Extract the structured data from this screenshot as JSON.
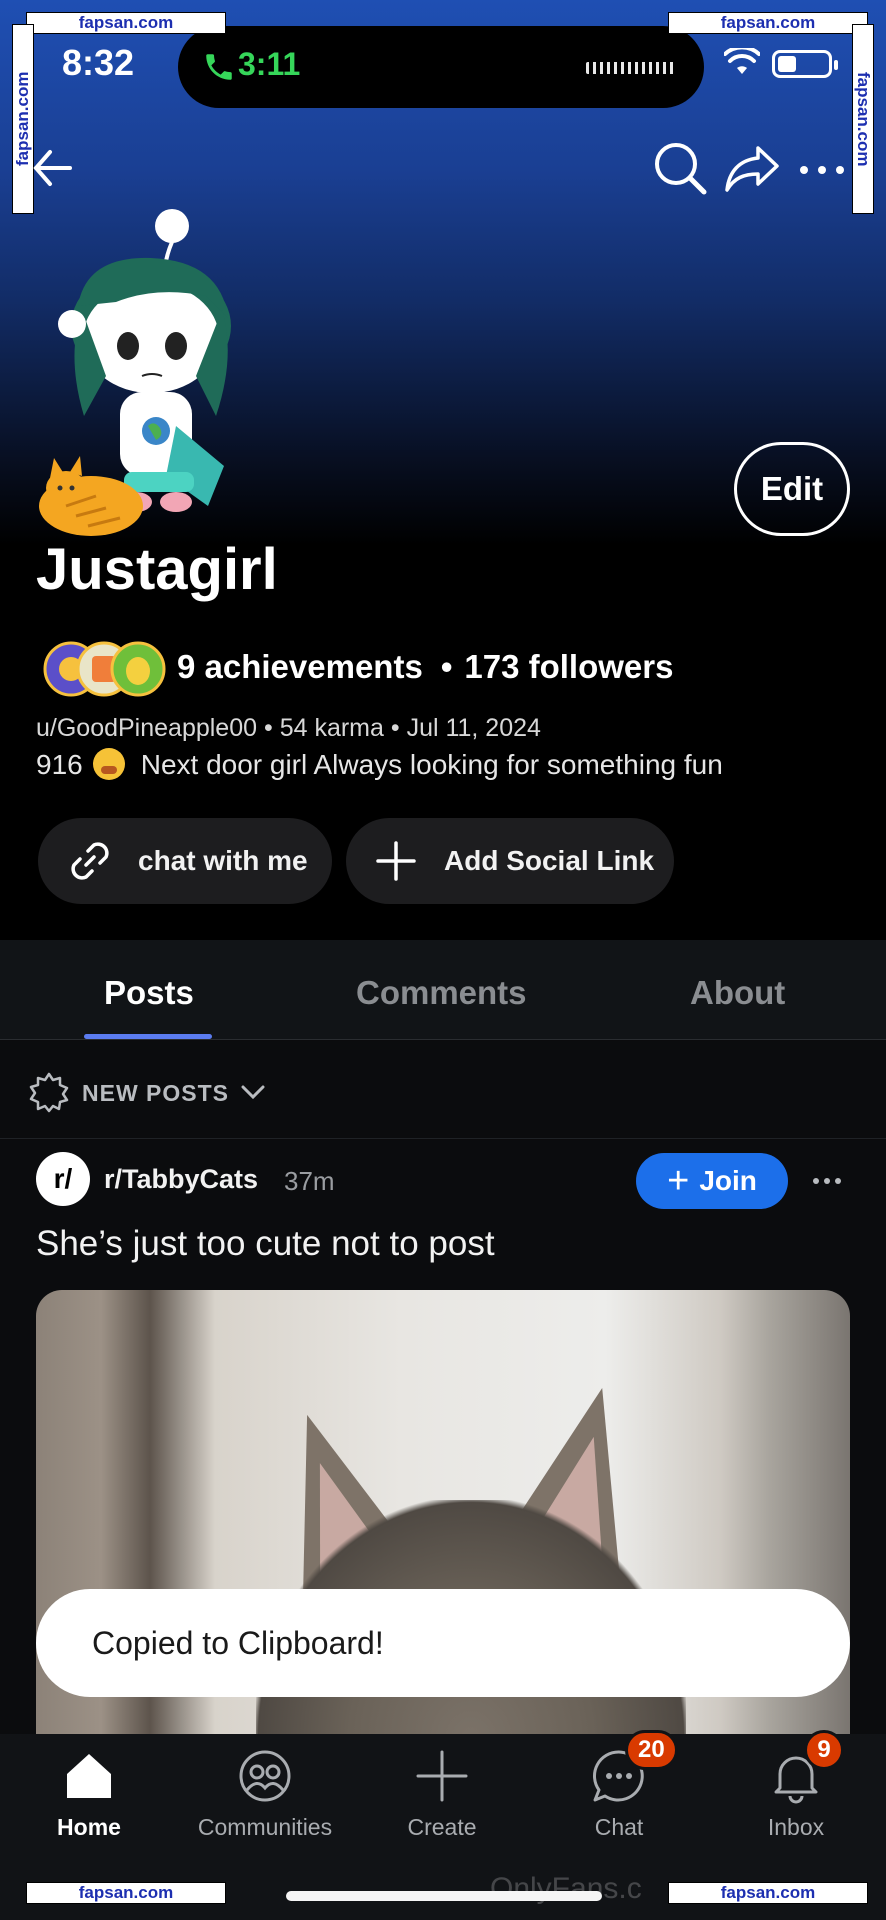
{
  "watermark": "fapsan.com",
  "status_bar": {
    "time": "8:32",
    "call_duration": "3:11"
  },
  "profile": {
    "display_name": "Justagirl",
    "achievements": "9 achievements",
    "followers": "173 followers",
    "meta": {
      "handle": "u/GoodPineapple00",
      "karma": "54 karma",
      "cake_day": "Jul 11, 2024"
    },
    "bio": {
      "prefix": "916",
      "text": "Next door girl  Always looking for something fun"
    },
    "edit_label": "Edit",
    "links": [
      {
        "label": "chat with me",
        "icon": "link-icon"
      },
      {
        "label": "Add Social Link",
        "icon": "plus-icon"
      }
    ]
  },
  "tabs": [
    {
      "label": "Posts",
      "active": true
    },
    {
      "label": "Comments",
      "active": false
    },
    {
      "label": "About",
      "active": false
    }
  ],
  "sort": {
    "label": "NEW POSTS"
  },
  "post": {
    "subreddit_icon": "r/",
    "subreddit": "r/TabbyCats",
    "age": "37m",
    "join_label": "Join",
    "title": "She’s just too cute not to post"
  },
  "toast": "Copied to Clipboard!",
  "bottom_nav": [
    {
      "label": "Home",
      "icon": "home-icon",
      "active": true
    },
    {
      "label": "Communities",
      "icon": "communities-icon"
    },
    {
      "label": "Create",
      "icon": "plus-icon"
    },
    {
      "label": "Chat",
      "icon": "chat-icon",
      "badge": "20"
    },
    {
      "label": "Inbox",
      "icon": "bell-icon",
      "badge": "9"
    }
  ],
  "bottom_watermark": "OnlyFans.c",
  "colors": {
    "accent": "#1c6fea",
    "tab_underline": "#5b7cf0",
    "badge": "#d93a00",
    "call_green": "#36d65a"
  }
}
